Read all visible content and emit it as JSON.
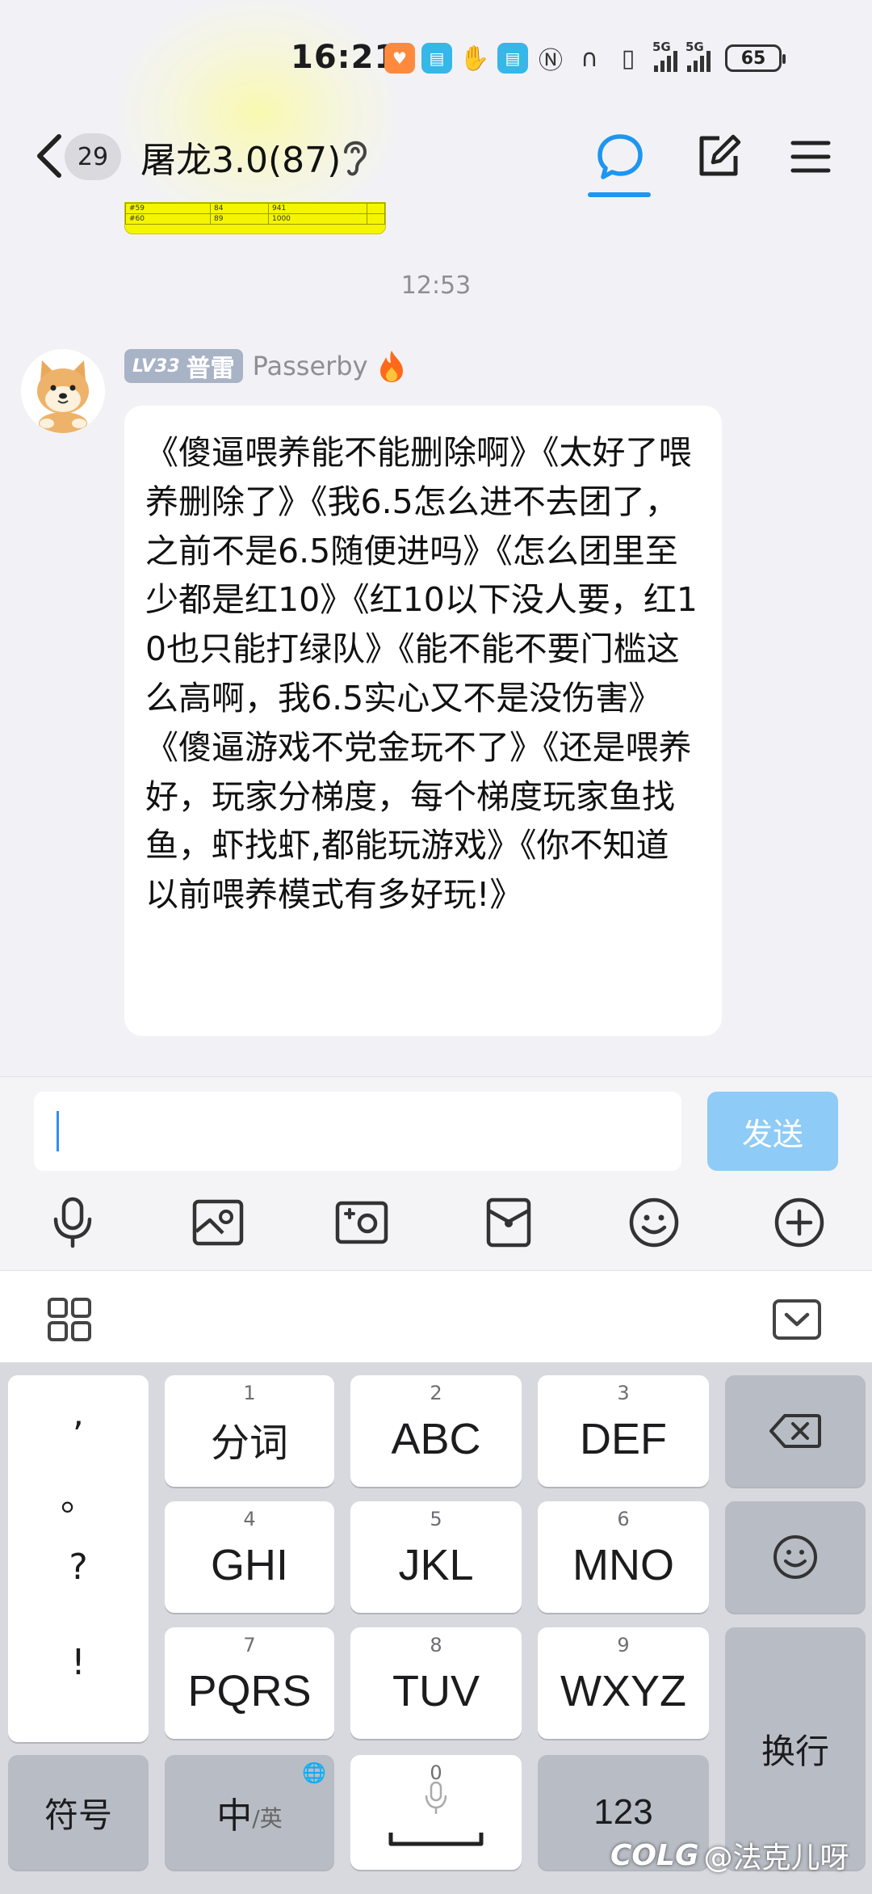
{
  "status_bar": {
    "time": "16:21",
    "signal_1": "5G",
    "signal_2": "5G",
    "battery": "65"
  },
  "header": {
    "unread_count": "29",
    "title": "屠龙3.0(87)"
  },
  "chat": {
    "timestamp": "12:53",
    "message": {
      "level": "LV33",
      "nickname_tag": "普雷",
      "sender": "Passerby",
      "text": "《傻逼喂养能不能删除啊》《太好了喂养删除了》《我6.5怎么进不去团了，之前不是6.5随便进吗》《怎么团里至少都是红10》《红10以下没人要，红10也只能打绿队》《能不能不要门槛这么高啊，我6.5实心又不是没伤害》《傻逼游戏不党金玩不了》《还是喂养好，玩家分梯度，每个梯度玩家鱼找鱼，虾找虾,都能玩游戏》《你不知道以前喂养模式有多好玩!》"
    },
    "image_snippet_rows": [
      [
        "#59",
        "84",
        "941"
      ],
      [
        "#60",
        "89",
        "1000"
      ]
    ]
  },
  "input": {
    "value": "",
    "send_label": "发送"
  },
  "keyboard": {
    "punct": [
      ",",
      "。",
      "?",
      "!"
    ],
    "keys": [
      {
        "num": "1",
        "label": "分词"
      },
      {
        "num": "2",
        "label": "ABC"
      },
      {
        "num": "3",
        "label": "DEF"
      },
      {
        "num": "4",
        "label": "GHI"
      },
      {
        "num": "5",
        "label": "JKL"
      },
      {
        "num": "6",
        "label": "MNO"
      },
      {
        "num": "7",
        "label": "PQRS"
      },
      {
        "num": "8",
        "label": "TUV"
      },
      {
        "num": "9",
        "label": "WXYZ"
      }
    ],
    "symbol_label": "符号",
    "lang_main": "中",
    "lang_alt": "/英",
    "space_num": "0",
    "numbers_label": "123",
    "enter_label": "换行"
  },
  "watermark": {
    "logo": "COLG",
    "user": "@法克儿呀"
  },
  "colors": {
    "accent": "#1e96f0",
    "send_button": "#8ecbf6",
    "level_badge": "#a9b3c6",
    "chat_bg": "#f2f2f6",
    "keyboard_bg": "#d7d9de"
  }
}
